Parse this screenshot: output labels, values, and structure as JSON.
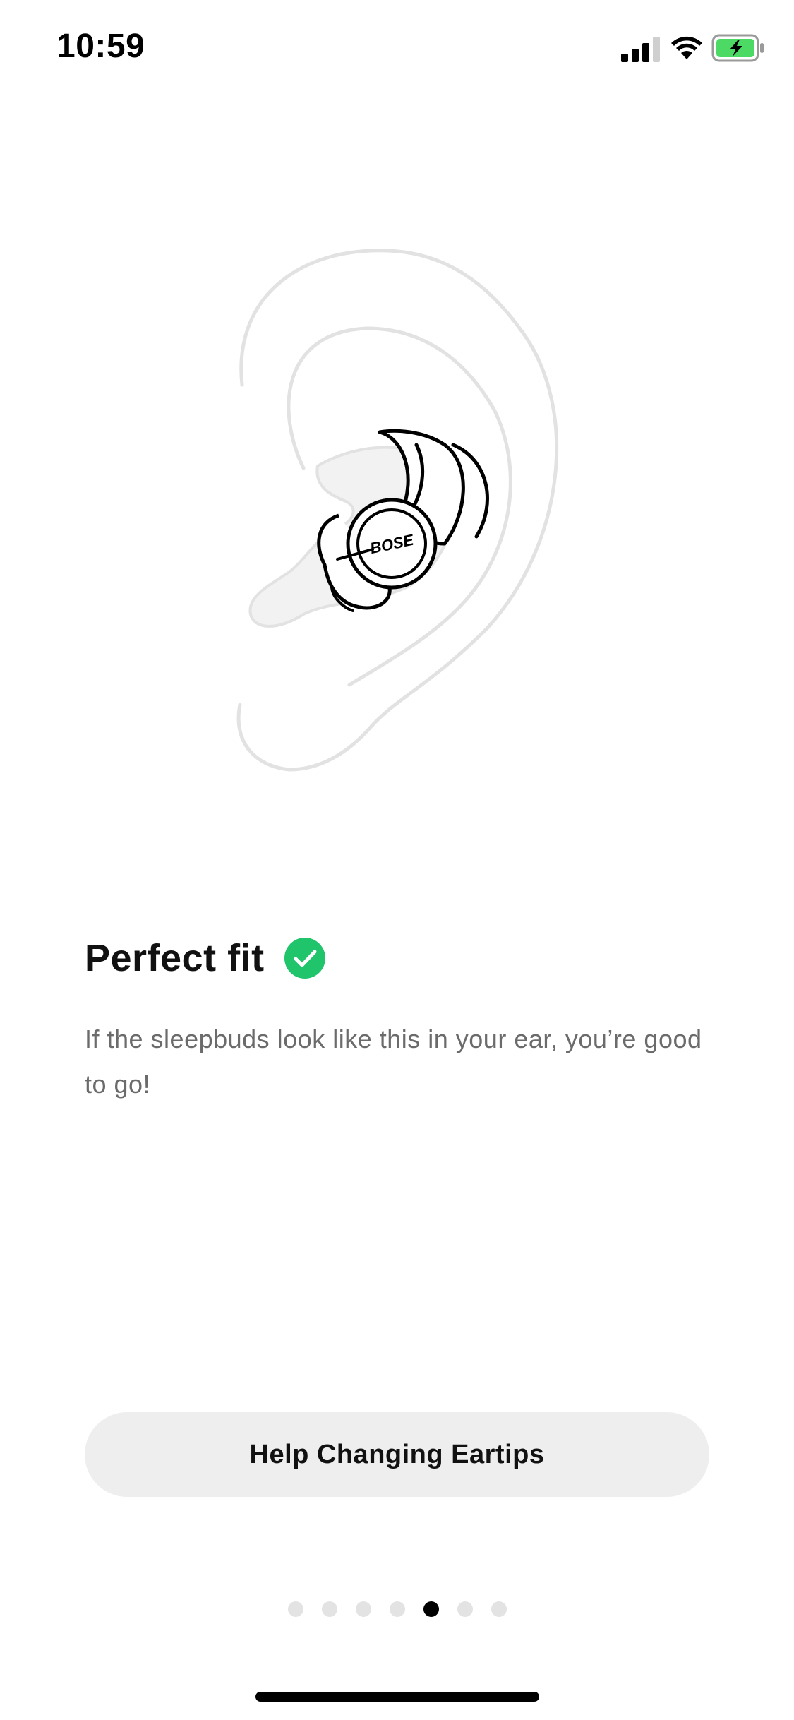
{
  "status_bar": {
    "time": "10:59",
    "signal_icon": "cellular-signal-icon",
    "wifi_icon": "wifi-icon",
    "battery_icon": "battery-charging-icon",
    "battery_color": "#4cd964"
  },
  "illustration": {
    "brand_text": "BOSE",
    "icon": "ear-with-sleepbud-illustration"
  },
  "content": {
    "title": "Perfect fit",
    "check_icon": "checkmark-circle-icon",
    "check_color": "#1fc46b",
    "description": "If the sleepbuds look like this in your ear, you’re good to go!"
  },
  "help_button": {
    "label": "Help Changing Eartips"
  },
  "pagination": {
    "total": 7,
    "current": 5
  }
}
